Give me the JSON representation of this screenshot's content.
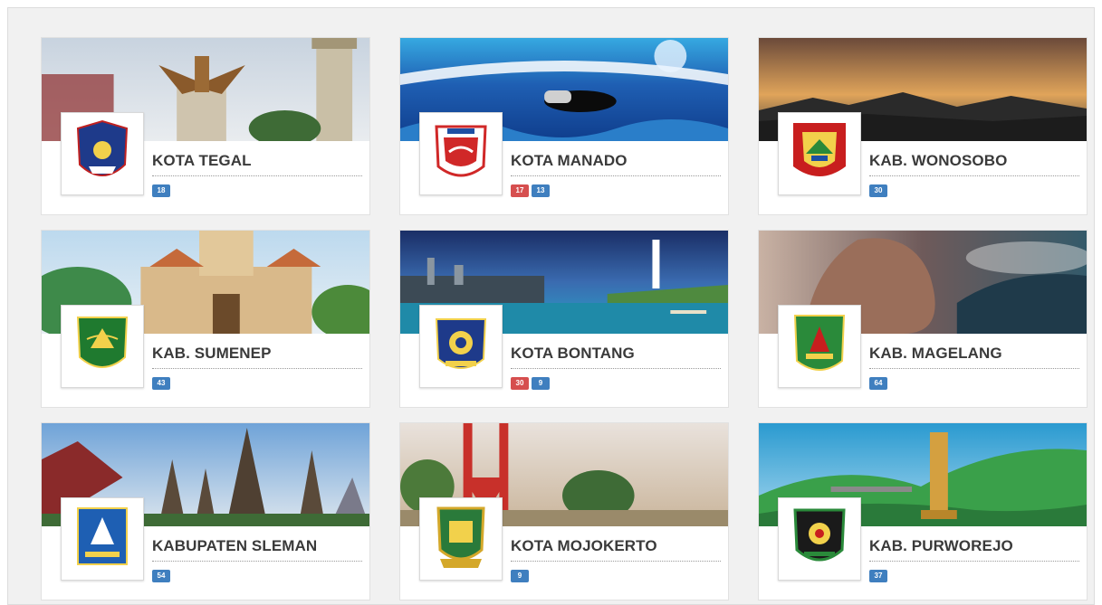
{
  "colors": {
    "badge_blue": "#3f7fbf",
    "badge_red": "#d64f4f",
    "title_text": "#3a3a3a"
  },
  "cards": [
    {
      "name": "KOTA TEGAL",
      "banner_icon": "garuda-monument-banner",
      "logo_icon": "kota-tegal-emblem-icon",
      "badges": [
        {
          "value": "18",
          "color": "blue"
        }
      ]
    },
    {
      "name": "KOTA MANADO",
      "banner_icon": "scuba-diver-banner",
      "logo_icon": "kota-manado-emblem-icon",
      "badges": [
        {
          "value": "17",
          "color": "red"
        },
        {
          "value": "13",
          "color": "blue"
        }
      ]
    },
    {
      "name": "KAB. WONOSOBO",
      "banner_icon": "mountain-sunset-banner",
      "logo_icon": "kab-wonosobo-emblem-icon",
      "badges": [
        {
          "value": "30",
          "color": "blue"
        }
      ]
    },
    {
      "name": "KAB. SUMENEP",
      "banner_icon": "palace-mosque-banner",
      "logo_icon": "kab-sumenep-emblem-icon",
      "badges": [
        {
          "value": "43",
          "color": "blue"
        }
      ]
    },
    {
      "name": "KOTA BONTANG",
      "banner_icon": "harbor-lighthouse-banner",
      "logo_icon": "kota-bontang-emblem-icon",
      "badges": [
        {
          "value": "30",
          "color": "red"
        },
        {
          "value": "9",
          "color": "blue"
        }
      ]
    },
    {
      "name": "KAB. MAGELANG",
      "banner_icon": "rock-cliff-banner",
      "logo_icon": "kab-magelang-emblem-icon",
      "badges": [
        {
          "value": "64",
          "color": "blue"
        }
      ]
    },
    {
      "name": "KABUPATEN SLEMAN",
      "banner_icon": "prambanan-temple-banner",
      "logo_icon": "kab-sleman-emblem-icon",
      "badges": [
        {
          "value": "54",
          "color": "blue"
        }
      ]
    },
    {
      "name": "KOTA MOJOKERTO",
      "banner_icon": "red-gate-monument-banner",
      "logo_icon": "kota-mojokerto-emblem-icon",
      "badges": [
        {
          "value": "9",
          "color": "blue"
        }
      ]
    },
    {
      "name": "KAB. PURWOREJO",
      "banner_icon": "statue-green-hills-banner",
      "logo_icon": "kab-purworejo-emblem-icon",
      "badges": [
        {
          "value": "37",
          "color": "blue"
        }
      ]
    }
  ]
}
